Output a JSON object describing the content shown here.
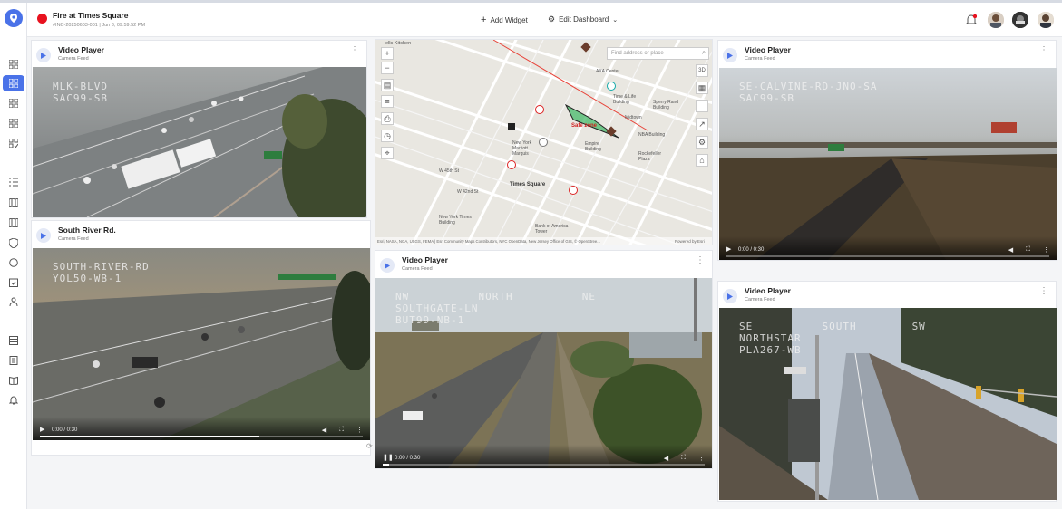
{
  "incident": {
    "title": "Fire at Times Square",
    "meta": "#INC-20250603-001 | Jun 3, 09:59:52 PM"
  },
  "header": {
    "add_widget": "Add Widget",
    "edit_dashboard": "Edit Dashboard"
  },
  "panels": {
    "p1": {
      "title": "Video Player",
      "subtitle": "Camera Feed",
      "overlay": "MLK-BLVD\nSAC99-SB"
    },
    "p2": {
      "title": "South River Rd.",
      "subtitle": "Camera Feed",
      "overlay": "SOUTH-RIVER-RD\nYOL50-WB-1",
      "time": "0:00 / 0:30"
    },
    "p3": {
      "title": "Video Player",
      "subtitle": "Camera Feed",
      "overlay": "NW          NORTH          NE\nSOUTHGATE-LN\nBUT99-NB-1",
      "time": "0:00 / 0:30"
    },
    "p4": {
      "title": "Video Player",
      "subtitle": "Camera Feed",
      "overlay": "SE-CALVINE-RD-JNO-SA\nSAC99-SB",
      "time": "0:00 / 0:30"
    },
    "p5": {
      "title": "Video Player",
      "subtitle": "Camera Feed",
      "overlay": "SE          SOUTH        SW\nNORTHSTAR\nPLA267-WB"
    }
  },
  "map": {
    "search_placeholder": "Find address or place",
    "btn_3d": "3D",
    "safe_zone": "Safe zone",
    "labels": {
      "hells_kitchen": "ells Kitchen",
      "times_square": "Times Square",
      "midtown": "Midtown",
      "nyma": "New York\nMarriott\nMarquis",
      "empire": "Empire\nBuilding",
      "rockefeller": "Rockefeller\nPlaza",
      "nyt": "New York Times\nBuilding",
      "boa": "Bank of America\nTower",
      "aaa": "AXA Center",
      "time_life": "Time & Life\nBuilding",
      "sperry": "Sperry Rand\nBuilding",
      "nba": "NBA Building",
      "st3": "W 45th St",
      "st4": "W 42nd St"
    },
    "attribution": "Esri, NASA, NGA, USGS, FEMA | Esri Community Maps Contributors, NYC OpenData, New Jersey Office of GIS, © OpenStree...",
    "powered": "Powered by Esri"
  }
}
